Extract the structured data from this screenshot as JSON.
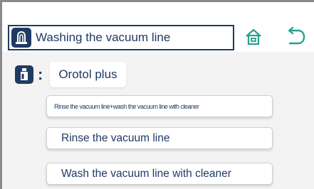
{
  "header": {
    "title": "Washing the vacuum line",
    "title_icon": "vacuum-line-icon",
    "home_icon": "home-icon",
    "back_icon": "back-arrow-icon"
  },
  "product": {
    "icon": "bottle-icon",
    "separator": ":",
    "name": "Orotol plus"
  },
  "options": [
    {
      "label": "Rinse the vacuum line+wash the vacuum line with cleaner"
    },
    {
      "label": "Rinse the vacuum line"
    },
    {
      "label": "Wash the vacuum line with cleaner"
    }
  ],
  "colors": {
    "primary": "#1f3a63",
    "accent": "#2a9d8f",
    "background": "#f3f3f3"
  }
}
